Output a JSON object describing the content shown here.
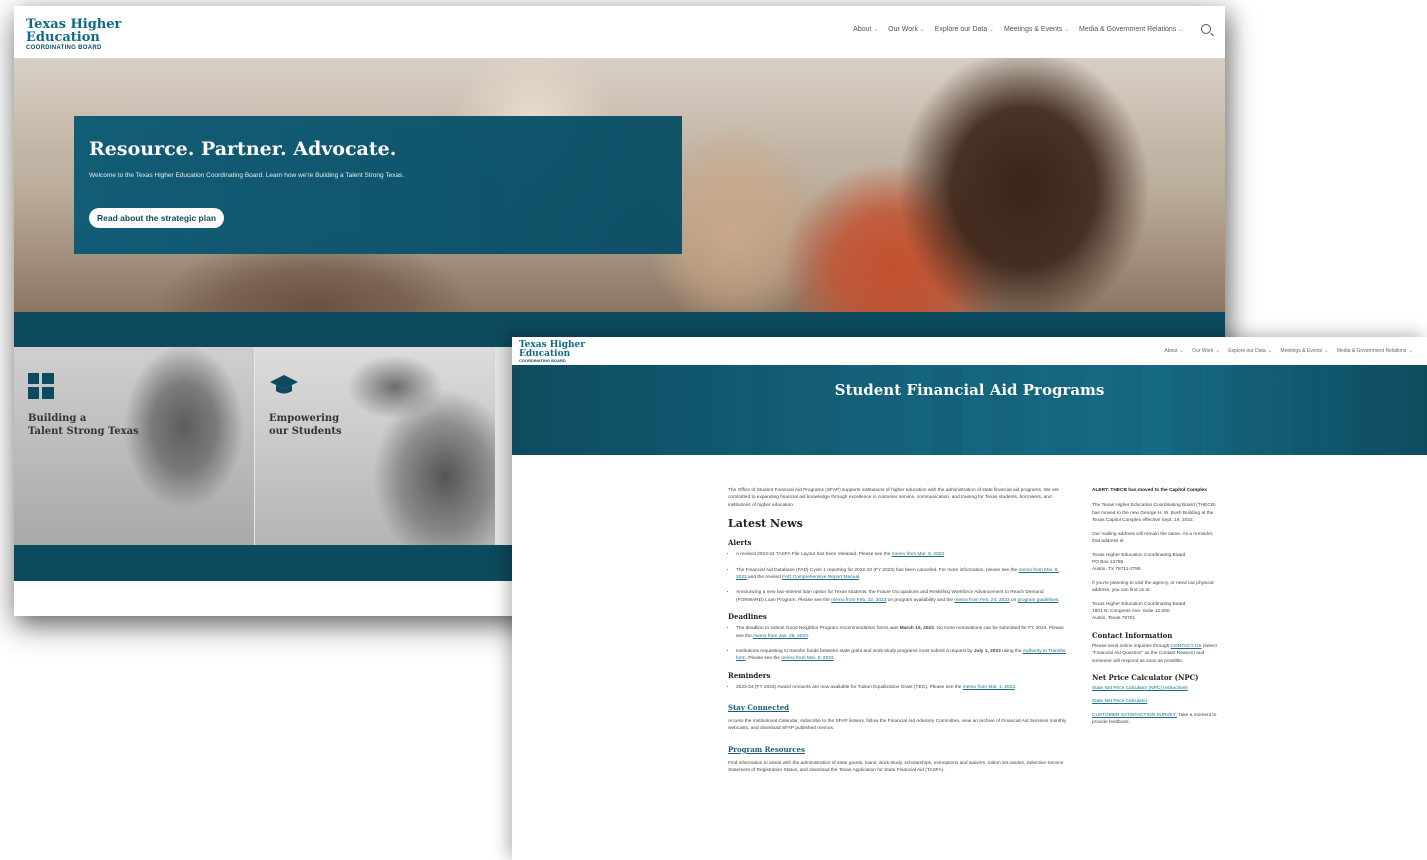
{
  "home": {
    "logo": {
      "line1": "Texas Higher",
      "line2": "Education",
      "line3": "COORDINATING BOARD"
    },
    "nav": [
      "About",
      "Our Work",
      "Explore our Data",
      "Meetings & Events",
      "Media & Government Relations"
    ],
    "hero": {
      "title": "Resource. Partner. Advocate.",
      "subtitle": "Welcome to the Texas Higher Education Coordinating Board. Learn how we're Building a Talent Strong Texas.",
      "button": "Read about the strategic plan"
    },
    "cards": [
      {
        "icon": "grid-icon",
        "line1": "Building a",
        "line2": "Talent Strong Texas"
      },
      {
        "icon": "graduation-cap-icon",
        "line1": "Empowering",
        "line2": "our Students"
      }
    ]
  },
  "sfap": {
    "logo": {
      "line1": "Texas Higher",
      "line2": "Education",
      "line3": "COORDINATING BOARD"
    },
    "nav": [
      "About",
      "Our Work",
      "Explore our Data",
      "Meetings & Events",
      "Media & Government Relations"
    ],
    "title": "Student Financial Aid Programs",
    "intro": "The Office of Student Financial Aid Programs (SFAP) supports institutions of higher education with the administration of state financial aid programs. We are committed to expanding financial aid knowledge through excellence in customer service, communication, and training for Texas students, borrowers, and institutions of higher education.",
    "latest_news": "Latest News",
    "alerts": {
      "heading": "Alerts",
      "i1_a": "A revised 2023-24 TASFA File Layout has been released. Please see the ",
      "i1_link": "memo from Mar. 9, 2023",
      "i1_b": ".",
      "i2_a": "The Financial Aid Database (FAD) Cycle 1 reporting for 2022-23 (FY 2023) has been canceled. For more information, please see the ",
      "i2_link1": "memo from Mar. 8, 2023",
      "i2_b": " and the revised ",
      "i2_link2": "FAD Comprehensive Report Manual",
      "i2_c": ".",
      "i3_a": "Announcing a new low-interest loan option for Texas students, the Future Occupations and Reskilling Workforce Advancement to Reach Demand (FORWARD) Loan Program. Please see the ",
      "i3_link1": "memo from Feb. 22, 2023",
      "i3_b": " on program availability and the ",
      "i3_link2": "memo from Feb. 24, 2023",
      "i3_c": " on ",
      "i3_link3": "program guidelines",
      "i3_d": "."
    },
    "deadlines": {
      "heading": "Deadlines",
      "i1_a": "The deadline to submit Good Neighbor Program recommendation forms was ",
      "i1_bold": "March 15, 2023",
      "i1_b": ". No more nominations can be submitted for FY 2024. Please see the ",
      "i1_link": "memo from Jan. 26, 2023",
      "i1_c": ".",
      "i2_a": "Institutions requesting to transfer funds between state grant and work-study programs must submit a request by ",
      "i2_bold": "July 1, 2023",
      "i2_b": " using the ",
      "i2_link1": "Authority to Transfer form",
      "i2_c": ". Please see the ",
      "i2_link2": "memo from Mar. 6, 2023",
      "i2_d": "."
    },
    "reminders": {
      "heading": "Reminders",
      "i1_a": "2023-24 (FY 2024) Award Amounts are now available for Tuition Equalization Grant (TEG). Please see the ",
      "i1_link": "memo from Mar. 1, 2023",
      "i1_b": "."
    },
    "stay_connected": {
      "heading": "Stay Connected",
      "text": "Access the Institutional Calendar, subscribe to the SFAP listserv, follow the Financial Aid Advisory Committee, view an archive of Financial Aid Services monthly webcasts, and download SFAP published memos."
    },
    "program_resources": {
      "heading": "Program Resources",
      "text": "Find information to assist with the administration of state grants, loans, work-study, scholarships, exemptions and waivers, tuition set-asides, Selective Service Statement of Registration Status, and download the Texas Application for State Financial Aid (TASFA)."
    },
    "sidebar": {
      "alert": "ALERT: THECB has moved to the Capitol Complex",
      "p1": "The Texas Higher Education Coordinating Board (THECB) has moved to the new George H. W. Bush Building at the Texas Capitol Complex effective Sept. 19, 2022.",
      "p2": "Our mailing address will remain the same. As a reminder, that address is:",
      "addr1": [
        "Texas Higher Education Coordinating Board",
        "PO Box 12788",
        "Austin, TX 78711-2788"
      ],
      "p3": "If you're planning to visit the agency, or need our physical address, you can find us at:",
      "addr2": [
        "Texas Higher Education Coordinating Board",
        "1801 N. Congress Ave. Suite 12.200",
        "Austin, Texas 78701"
      ],
      "contact_heading": "Contact Information",
      "contact_a": "Please send online inquiries through ",
      "contact_link": "CONTACT US",
      "contact_b": " (select \"Financial Aid Question\" as the Contact Reason) and someone will respond as soon as possible.",
      "npc_heading": "Net Price Calculator (NPC)",
      "npc_link1": "State Net Price Calculator (NPC) Instructions",
      "npc_link2": "State Net Price Calculator",
      "survey_link": "CUSTOMER SATISFACTION SURVEY:",
      "survey_text": " Take a moment to provide feedback."
    }
  }
}
